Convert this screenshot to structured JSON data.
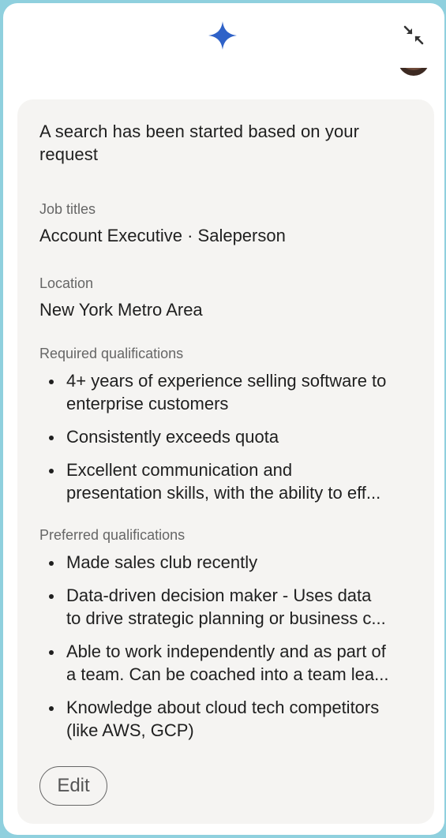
{
  "header": {
    "icon": "sparkle-icon",
    "accent_color": "#2f62c8",
    "collapse_icon": "collapse-arrows-icon"
  },
  "card": {
    "intro": "A search has been started based on your request",
    "job_titles": {
      "label": "Job titles",
      "value": "Account Executive · Saleperson"
    },
    "location": {
      "label": "Location",
      "value": "New York Metro Area"
    },
    "required": {
      "label": "Required qualifications",
      "items": [
        "4+ years of experience selling software to\nenterprise customers",
        "Consistently exceeds quota",
        "Excellent communication and\npresentation skills, with the ability to eff..."
      ]
    },
    "preferred": {
      "label": "Preferred qualifications",
      "items": [
        "Made sales club recently",
        "Data-driven decision maker - Uses data\nto drive strategic planning or business c...",
        "Able to work independently and as part of\na team. Can be coached into a team lea...",
        "Knowledge about cloud tech competitors\n(like AWS, GCP)"
      ]
    },
    "edit_label": "Edit"
  }
}
